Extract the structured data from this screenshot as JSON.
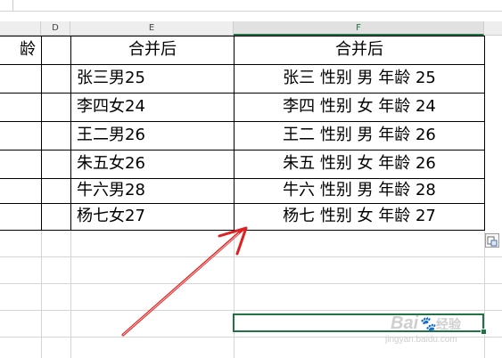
{
  "columns": {
    "d": "D",
    "e": "E",
    "f": "F"
  },
  "partial_header_left": "龄",
  "header_row": {
    "e": "合并后",
    "f": "合并后"
  },
  "rows": [
    {
      "e": "张三男25",
      "f": "张三 性别 男 年龄 25"
    },
    {
      "e": "李四女24",
      "f": "李四 性别 女 年龄 24"
    },
    {
      "e": "王二男26",
      "f": "王二 性别 男 年龄 26"
    },
    {
      "e": "朱五女26",
      "f": "朱五 性别 女 年龄 26"
    },
    {
      "e": "牛六男28",
      "f": "牛六 性别 男 年龄 28"
    },
    {
      "e": "杨七女27",
      "f": "杨七 性别 女 年龄 27"
    }
  ],
  "watermark": {
    "brand": "Bai",
    "brand_suffix": "经验",
    "url": "jingyan.baidu.com"
  },
  "icons": {
    "paste_options": "paste-options-icon",
    "arrow": "red-arrow-annotation"
  },
  "colors": {
    "selection": "#217346",
    "arrow": "#e02020"
  }
}
